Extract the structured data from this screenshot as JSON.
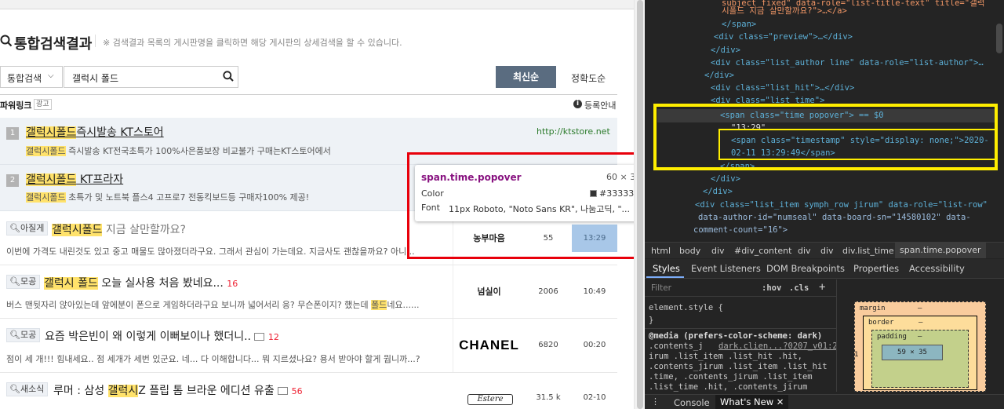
{
  "search": {
    "title": "통합검색결과",
    "description": "※ 검색결과 목록의 게시판명을 클릭하면 해당 게시판의 상세검색을 할 수 있습니다.",
    "scope": "통합검색",
    "query": "갤럭시 폴드",
    "sort_latest": "최신순",
    "sort_accuracy": "정확도순"
  },
  "powerlink": {
    "label": "파워링크",
    "ad_badge": "광고",
    "register": "등록안내",
    "ads": [
      {
        "num": "1",
        "title_hl": "갤럭시폴드",
        "title_rest": "즉시발송 KT스토어",
        "url": "http://ktstore.net",
        "desc_hl": "갤럭시폴드",
        "desc_rest": " 즉시발송 KT전국초특가 100%사은품보장 비교불가 구매는KT스토어에서"
      },
      {
        "num": "2",
        "title_hl": "갤럭시폴드",
        "title_rest": " KT프라자",
        "desc_hl": "갤럭시폴드",
        "desc_rest": " 초특가 및 노트북 플스4 고프로7 전동킥보드등 구매자100% 제공!"
      }
    ]
  },
  "posts": [
    {
      "board": "아질게",
      "title_pre": "",
      "title_hl": "갤럭시폴드",
      "title_post": " 지금 살만할까요?",
      "comments": "",
      "preview_pre": "이번에 가격도 내린것도 있고 중고 매물도 많아졌더라구요. 그래서 관심이 가는데요. 지금사도 괜찮을까요? 아니...",
      "preview_hl": "",
      "preview_post": "",
      "author": "농부마음",
      "hits": "55",
      "time": "13:29"
    },
    {
      "board": "모공",
      "title_pre": "",
      "title_hl": "갤럭시 폴드",
      "title_post": " 오늘 실사용 처음 봤네요...",
      "comments": "16",
      "preview_pre": "버스 맨뒷자리 앉아있는데 앞에분이 폰으로 게임하더라구요 보니까 넓어서리 응? 무슨폰이지? 했는데 ",
      "preview_hl": "폴드",
      "preview_post": "네요......",
      "author": "넘실이",
      "hits": "2006",
      "time": "10:49"
    },
    {
      "board": "모공",
      "title_pre": "",
      "title_hl": "",
      "title_post": "요즘 박은빈이 왜 이렇게 이뻐보이나 했더니..",
      "comments": "12",
      "preview_pre": "점이 세 개!!! 힘내세요.. 점 세개가 세번 있군요. 네... 다 이해합니다... 뭐 지르셨나요? 용서 받아야 할게 뭡니까...?",
      "preview_hl": "",
      "preview_post": "",
      "author": "CHANEL",
      "hits": "6820",
      "time": "00:20"
    },
    {
      "board": "새소식",
      "title_pre": "루머 : 삼성 ",
      "title_hl": "갤럭시",
      "title_post": "Z 플립 톰 브라운 에디션 유출",
      "comments": "56",
      "preview_pre": "",
      "preview_hl": "",
      "preview_post": "",
      "author": "Estere",
      "hits": "31.5 k",
      "time": "02-10"
    }
  ],
  "tooltip": {
    "selector": "span.time.popover",
    "size": "60 × 35",
    "color_label": "Color",
    "color_value": "#333333",
    "font_label": "Font",
    "font_value": "11px Roboto, \"Noto Sans KR\", 나눔고딕, \"..."
  },
  "devtools": {
    "breadcrumbs": [
      "html",
      "body",
      "div",
      "#div_content",
      "div",
      "div",
      "div.list_time",
      "span.time.popover"
    ],
    "tabs": [
      "Styles",
      "Event Listeners",
      "DOM Breakpoints",
      "Properties",
      "Accessibility"
    ],
    "filter_placeholder": "Filter",
    "hov": ":hov",
    "cls": ".cls",
    "add": "+",
    "styles_lines": [
      "element.style {",
      "}",
      "@media (prefers-color-scheme: dark)",
      ".contents_j",
      "dark.clien...?0207_v01:2",
      "irum .list_item .list_hit .hit,",
      ".contents_jirum .list_item .list_hit",
      ".time, .contents_jirum .list_item",
      ".list_time .hit, .contents_jirum"
    ],
    "box": {
      "margin": "margin",
      "margin_val": "–",
      "border": "border",
      "border_val": "–",
      "padding": "padding",
      "padding_val": "–",
      "content": "59 × 35",
      "side_left": "1",
      "side_right": "–",
      "bottom": "–"
    },
    "drawer_tabs": [
      "Console",
      "What's New"
    ],
    "html_lines": {
      "l1_text": "subject_fixed\" data-role=\"list-title-text\" title=\"갤럭",
      "l2_text": "시폴드 지금 살만할까요?\">…</a>",
      "l3": "</span>",
      "l4": "<div class=\"preview\">…</div>",
      "l5": "</div>",
      "l6": "<div class=\"list_author line\" data-role=\"list-author\">…",
      "l7": "</div>",
      "l8": "<div class=\"list_hit\">…</div>",
      "l9": "<div class=\"list_time\">",
      "l10": "<span class=\"time popover\"> == $0",
      "l11": "\"13:29\"",
      "l12": "<span class=\"timestamp\" style=\"display: none;\">2020-",
      "l13": "02-11 13:29:49</span>",
      "l14": "</span>",
      "l15": "</div>",
      "l16": "</div>",
      "l17": "<div class=\"list_item symph_row jirum\" data-role=\"list-row\"",
      "l18": "data-author-id=\"numseal\" data-board-sn=\"14580102\" data-",
      "l19": "comment-count=\"16\">"
    }
  },
  "colors": {
    "highlight": "#ffe26b",
    "annotation": "#e8000b",
    "yellow_box": "#ffee00",
    "selected_time": "#a8c7e8"
  }
}
